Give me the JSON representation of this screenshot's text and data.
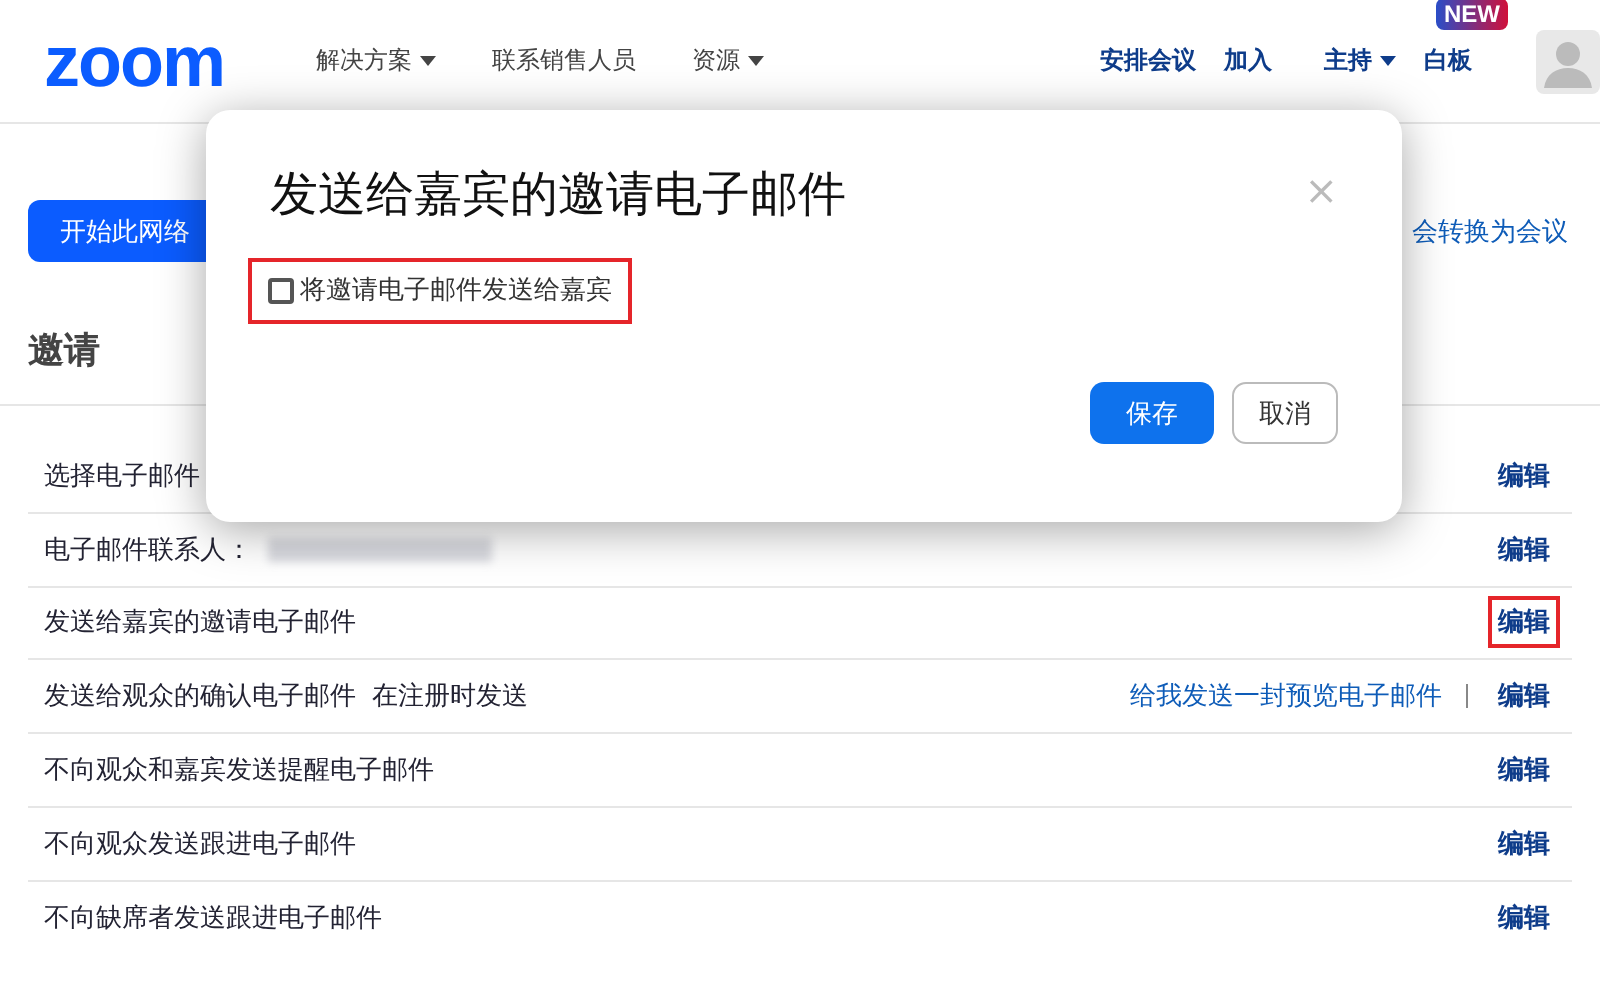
{
  "header": {
    "logo": "zoom",
    "nav": [
      {
        "label": "解决方案",
        "dropdown": true
      },
      {
        "label": "联系销售人员",
        "dropdown": false
      },
      {
        "label": "资源",
        "dropdown": true
      }
    ],
    "actions": [
      {
        "label": "安排会议",
        "dropdown": false
      },
      {
        "label": "加入",
        "dropdown": false
      },
      {
        "label": "主持",
        "dropdown": true
      },
      {
        "label": "白板",
        "dropdown": false
      }
    ],
    "new_badge": "NEW"
  },
  "toolbar": {
    "start_button": "开始此网络",
    "convert_link": "会转换为会议"
  },
  "tabs": [
    {
      "label": "邀请",
      "selected": false
    }
  ],
  "rows": [
    {
      "label": "选择电子邮件",
      "edit": "编辑",
      "blurred_value": false,
      "highlighted": false
    },
    {
      "label": "电子邮件联系人：",
      "edit": "编辑",
      "blurred_value": true,
      "highlighted": false
    },
    {
      "label": "发送给嘉宾的邀请电子邮件",
      "edit": "编辑",
      "blurred_value": false,
      "highlighted": true
    },
    {
      "label": "发送给观众的确认电子邮件",
      "extra": "在注册时发送",
      "preview_link": "给我发送一封预览电子邮件",
      "edit": "编辑",
      "blurred_value": false,
      "highlighted": false
    },
    {
      "label": "不向观众和嘉宾发送提醒电子邮件",
      "edit": "编辑",
      "blurred_value": false,
      "highlighted": false
    },
    {
      "label": "不向观众发送跟进电子邮件",
      "edit": "编辑",
      "blurred_value": false,
      "highlighted": false
    },
    {
      "label": "不向缺席者发送跟进电子邮件",
      "edit": "编辑",
      "blurred_value": false,
      "highlighted": false
    }
  ],
  "dialog": {
    "title": "发送给嘉宾的邀请电子邮件",
    "close": "×",
    "checkbox": {
      "label": "将邀请电子邮件发送给嘉宾",
      "checked": false,
      "highlighted": true
    },
    "buttons": [
      {
        "label": "保存",
        "kind": "primary"
      },
      {
        "label": "取消",
        "kind": "secondary"
      }
    ]
  }
}
